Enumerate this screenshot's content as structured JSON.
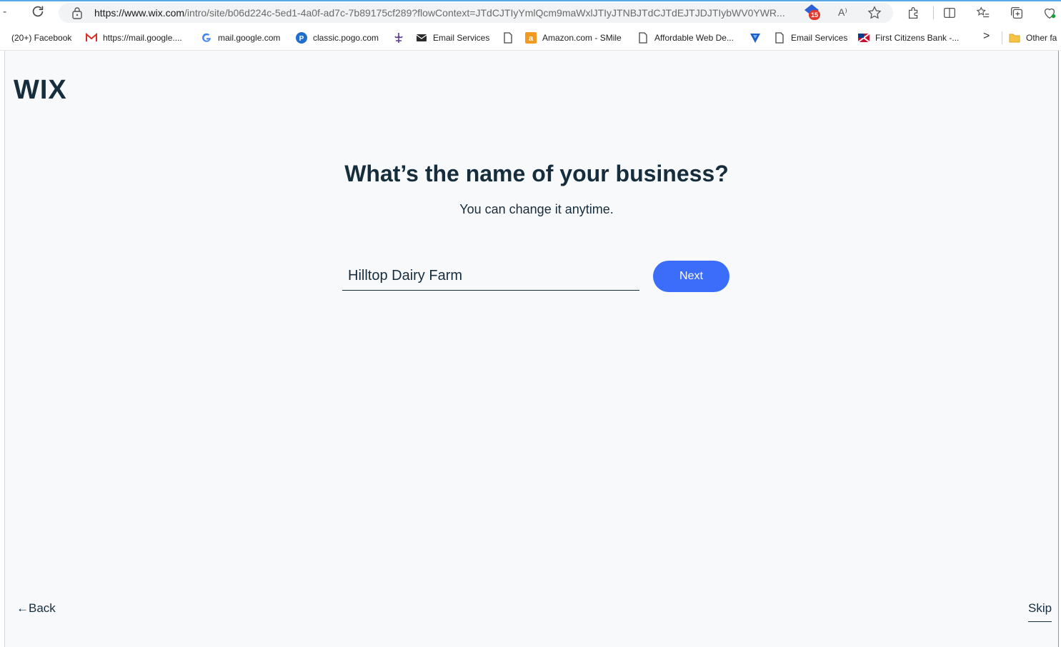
{
  "browser": {
    "back_stub": "-",
    "url_host": "https://www.wix.com",
    "url_path": "/intro/site/b06d224c-5ed1-4a0f-ad7c-7b89175cf289?flowContext=JTdCJTIyYmlQcm9maWxlJTIyJTNBJTdCJTdEJTJDJTIybWV0YWR...",
    "extension_badge_count": "15",
    "read_aloud_label": "A⁾"
  },
  "bookmarks": {
    "items": [
      {
        "label": "(20+) Facebook",
        "icon": "facebook-icon"
      },
      {
        "label": "https://mail.google....",
        "icon": "gmail-icon"
      },
      {
        "label": "mail.google.com",
        "icon": "google-icon"
      },
      {
        "label": "classic.pogo.com",
        "icon": "pogo-icon"
      },
      {
        "label": "",
        "icon": "scout-icon"
      },
      {
        "label": "Email Services",
        "icon": "envelope-icon"
      },
      {
        "label": "",
        "icon": "page-icon"
      },
      {
        "label": "Amazon.com - SMile",
        "icon": "amazon-icon"
      },
      {
        "label": "Affordable Web De...",
        "icon": "page-icon"
      },
      {
        "label": "",
        "icon": "v-logo-icon"
      },
      {
        "label": "Email Services",
        "icon": "page-icon"
      },
      {
        "label": "First Citizens Bank -...",
        "icon": "flag-icon"
      }
    ],
    "more_chevron": ">",
    "other_folder": "Other fa"
  },
  "page": {
    "logo": "WIX",
    "title": "What’s the name of your business?",
    "subtitle": "You can change it anytime.",
    "business_name_value": "Hilltop Dairy Farm",
    "next_label": "Next",
    "back_label": "←Back",
    "skip_label": "Skip"
  },
  "colors": {
    "primary": "#3b6dfa",
    "text": "#162d3d",
    "page_bg": "#f8f9fa"
  }
}
